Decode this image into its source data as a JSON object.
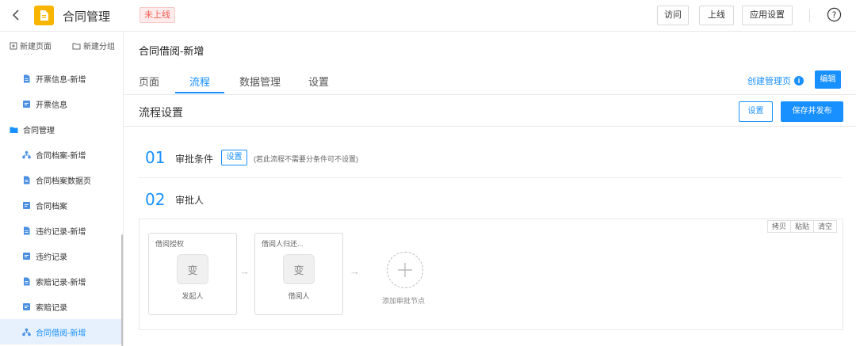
{
  "app": {
    "title": "合同管理",
    "status_badge": "未上线"
  },
  "topbar": {
    "visit": "访问",
    "publish": "上线",
    "app_settings": "应用设置"
  },
  "sidebar": {
    "new_page": "新建页面",
    "new_group": "新建分组",
    "items": [
      {
        "label": "开票信息-新增",
        "icon": "form-icon"
      },
      {
        "label": "开票信息",
        "icon": "report-icon"
      },
      {
        "label": "合同管理",
        "icon": "folder-icon"
      },
      {
        "label": "合同档案-新增",
        "icon": "flow-icon"
      },
      {
        "label": "合同档案数据页",
        "icon": "form-icon"
      },
      {
        "label": "合同档案",
        "icon": "report-icon"
      },
      {
        "label": "违约记录-新增",
        "icon": "form-icon"
      },
      {
        "label": "违约记录",
        "icon": "report-icon"
      },
      {
        "label": "索赔记录-新增",
        "icon": "form-icon"
      },
      {
        "label": "索赔记录",
        "icon": "report-icon"
      },
      {
        "label": "合同借阅-新增",
        "icon": "flow-icon"
      }
    ]
  },
  "page": {
    "title": "合同借阅-新增"
  },
  "tabs": [
    "页面",
    "流程",
    "数据管理",
    "设置"
  ],
  "header_actions": {
    "create_mgr": "创建管理页",
    "edit": "编辑"
  },
  "section": {
    "title": "流程设置",
    "settings": "设置",
    "save_publish": "保存并发布"
  },
  "steps": {
    "s1": {
      "num": "01",
      "label": "审批条件",
      "button": "设置",
      "hint": "(若此流程不需要分条件可不设置)"
    },
    "s2": {
      "num": "02",
      "label": "审批人"
    }
  },
  "canvas_tools": [
    "拷贝",
    "粘贴",
    "清空"
  ],
  "nodes": [
    {
      "title": "借阅授权",
      "glyph": "变",
      "role": "发起人"
    },
    {
      "title": "借阅人归还...",
      "glyph": "变",
      "role": "借阅人"
    }
  ],
  "add_node_label": "添加审批节点",
  "colors": {
    "accent": "#1890ff",
    "app_icon": "#f7b500",
    "badge": "#f25c54"
  }
}
